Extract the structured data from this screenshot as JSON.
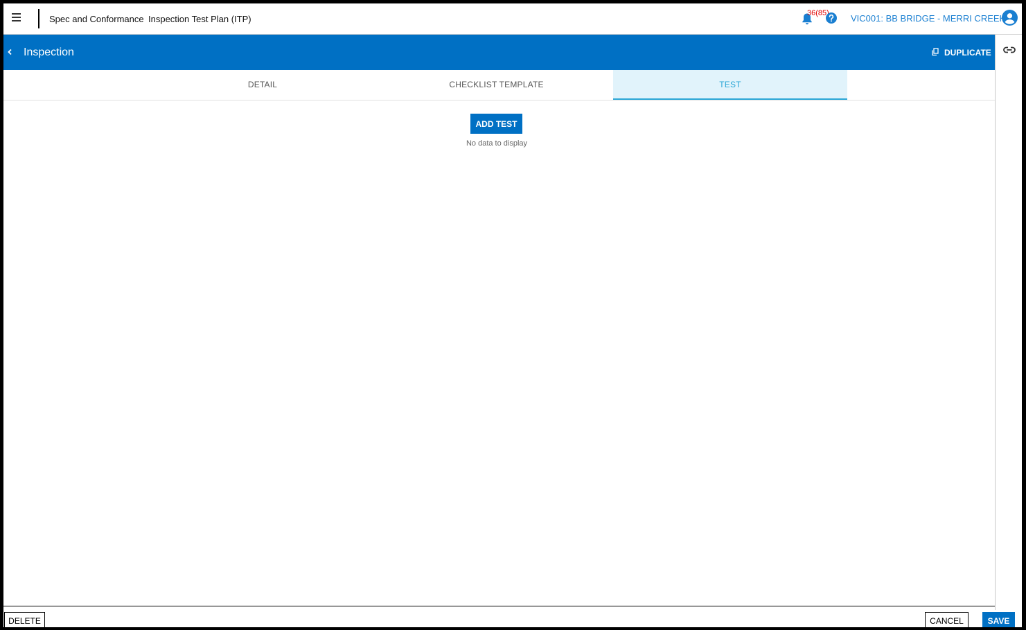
{
  "header": {
    "breadcrumb_module": "Spec and Conformance",
    "breadcrumb_page": "Inspection Test Plan (ITP)",
    "notification_count": "36(85)",
    "project_name": "VIC001: BB BRIDGE - MERRI CREEK",
    "icons": [
      "menu-icon",
      "bell-icon",
      "help-icon",
      "account-icon"
    ]
  },
  "titlebar": {
    "title": "Inspection",
    "duplicate_label": "DUPLICATE",
    "icons": [
      "chevron-left-icon",
      "copy-icon"
    ]
  },
  "rail": {
    "icons": [
      "link-icon"
    ]
  },
  "tabs": [
    {
      "label": "DETAIL",
      "active": false
    },
    {
      "label": "CHECKLIST TEMPLATE",
      "active": false
    },
    {
      "label": "TEST",
      "active": true
    }
  ],
  "content": {
    "add_test_label": "ADD TEST",
    "empty_message": "No data to display"
  },
  "footer": {
    "delete_label": "DELETE",
    "cancel_label": "CANCEL",
    "save_label": "SAVE"
  },
  "colors": {
    "primary": "#0070c4",
    "tab_active_bg": "#e1f3fb",
    "tab_active_text": "#29a6d6",
    "link_text": "#1a7fd1",
    "notification": "#e00000"
  }
}
